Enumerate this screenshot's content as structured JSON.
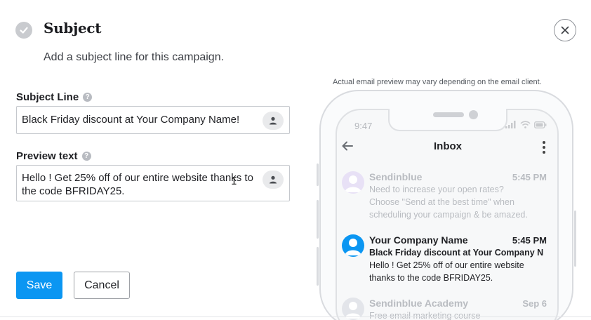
{
  "header": {
    "title": "Subject",
    "subtitle": "Add a subject line for this campaign."
  },
  "form": {
    "subject_label": "Subject Line",
    "subject_value": "Black Friday discount at Your Company Name!",
    "preview_label": "Preview text",
    "preview_value": "Hello ! Get 25% off of our entire website thanks to the code BFRIDAY25.",
    "save_label": "Save",
    "cancel_label": "Cancel"
  },
  "preview": {
    "notice": "Actual email preview may vary depending on the email client.",
    "phone_time": "9:47",
    "inbox_title": "Inbox",
    "emails": [
      {
        "sender": "Sendinblue",
        "time": "5:45 PM",
        "line1": "Need to increase your open rates?",
        "line2": "Choose \"Send at the best time\" when",
        "line3": "scheduling your campaign & be amazed."
      },
      {
        "sender": "Your Company Name",
        "time": "5:45 PM",
        "subject": "Black Friday discount at Your Company N",
        "line1": "Hello ! Get 25% off of our entire website",
        "line2": "thanks to the code BFRIDAY25."
      },
      {
        "sender": "Sendinblue Academy",
        "time": "Sep 6",
        "line1": "Free email marketing course"
      }
    ]
  },
  "colors": {
    "accent": "#0b96f2",
    "faded_avatar": "#e4dcf5"
  },
  "icons": [
    "check-circle-icon",
    "close-icon",
    "help-icon",
    "person-icon",
    "back-arrow-icon",
    "more-vertical-icon",
    "signal-icon",
    "wifi-icon",
    "battery-icon"
  ]
}
